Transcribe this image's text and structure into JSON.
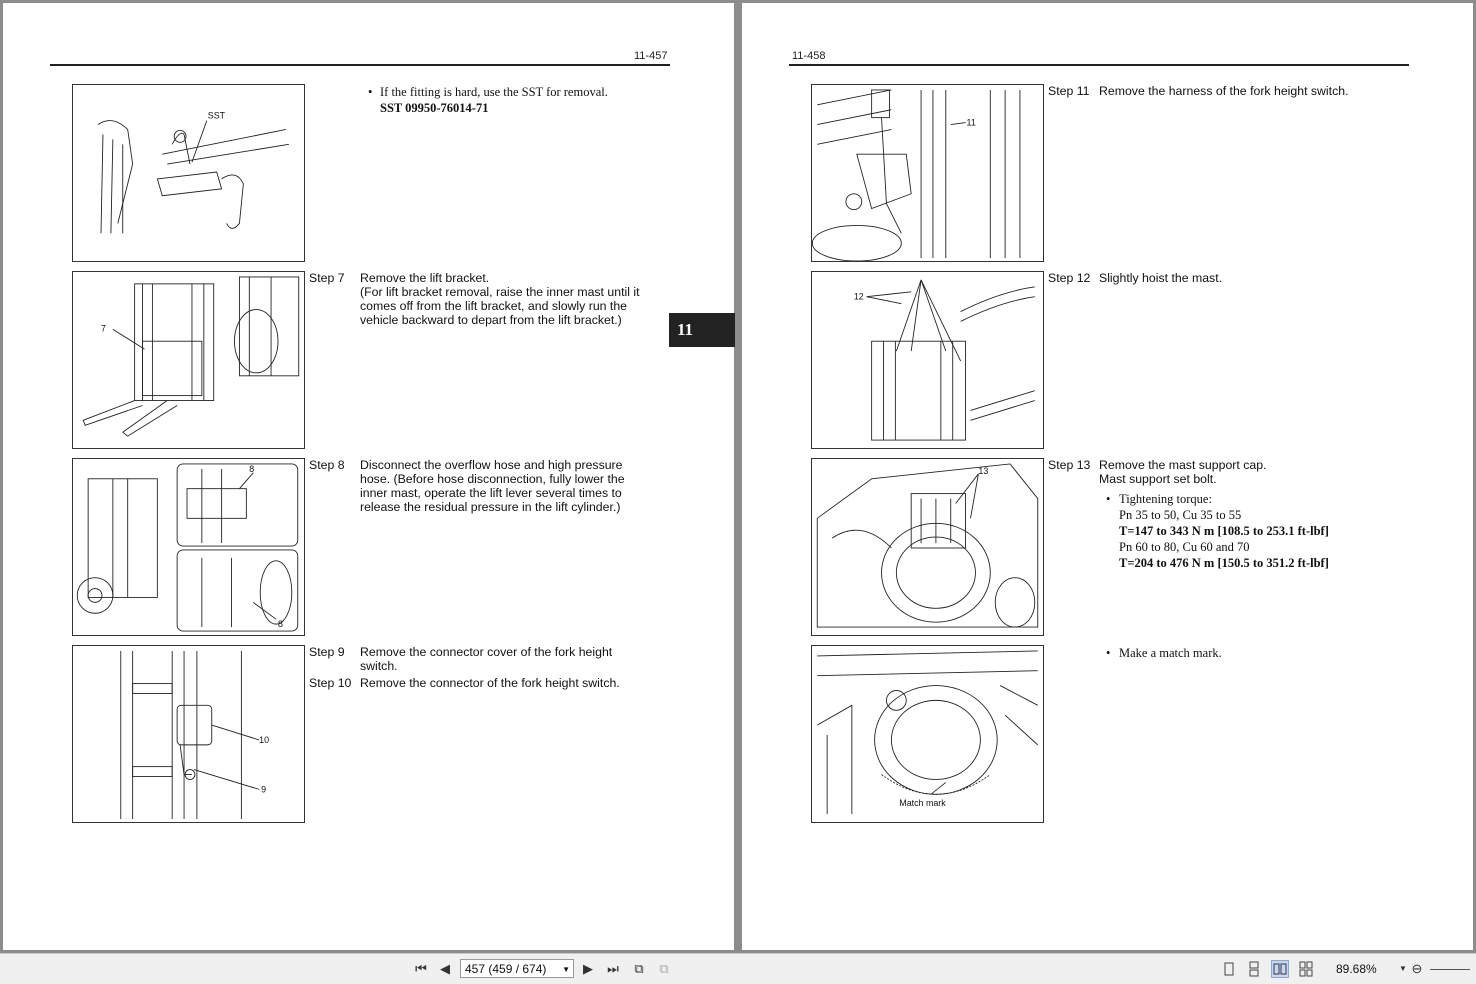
{
  "left_page": {
    "page_number": "11-457",
    "bullet_sst": "If the fitting is hard, use the SST for removal.",
    "sst_code": "SST 09950-76014-71",
    "fig1_label": "SST",
    "steps": [
      {
        "no": "Step 7",
        "text": "Remove the lift bracket.\n(For lift bracket removal, raise the inner mast until it comes off from the lift bracket, and slowly run the vehicle backward to depart from the lift bracket.)",
        "callout": "7"
      },
      {
        "no": "Step 8",
        "text": "Disconnect the overflow hose and high pressure hose. (Before hose disconnection, fully lower the inner mast, operate the lift lever several times to release the residual pressure in the lift cylinder.)",
        "callout": "8"
      },
      {
        "no": "Step 9",
        "text": "Remove the connector cover of the fork height switch.",
        "callout": "9"
      },
      {
        "no": "Step 10",
        "text": "Remove the connector of the fork height switch.",
        "callout": "10"
      }
    ]
  },
  "chapter_tab": "11",
  "right_page": {
    "page_number": "11-458",
    "steps": [
      {
        "no": "Step 11",
        "text": "Remove the harness of the fork height switch.",
        "callout": "11"
      },
      {
        "no": "Step 12",
        "text": "Slightly hoist the mast.",
        "callout": "12"
      },
      {
        "no": "Step 13",
        "text": "Remove the mast support cap.\nMast support set bolt.",
        "callout": "13"
      }
    ],
    "torque": {
      "label": "Tightening torque:",
      "spec1_models": "Pn 35 to 50, Cu 35 to 55",
      "spec1_value": "T=147 to 343 N m [108.5 to 253.1 ft-lbf]",
      "spec2_models": "Pn 60 to 80, Cu 60 and 70",
      "spec2_value": "T=204 to 476 N m [150.5 to 351.2 ft-lbf]"
    },
    "bullet_match": "Make a match mark.",
    "fig_match_label": "Match mark"
  },
  "toolbar": {
    "page_display": "457 (459 / 674)",
    "zoom": "89.68%"
  }
}
